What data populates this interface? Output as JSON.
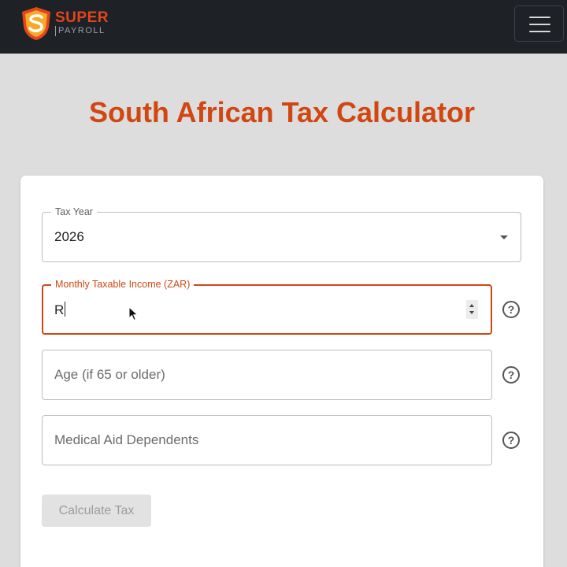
{
  "header": {
    "brand_top": "SUPER",
    "brand_bottom": "PAYROLL",
    "logo_icon": "shield-s-logo",
    "menu_icon": "hamburger-menu-icon"
  },
  "page": {
    "title": "South African Tax Calculator"
  },
  "form": {
    "tax_year": {
      "label": "Tax Year",
      "value": "2026"
    },
    "income": {
      "label": "Monthly Taxable Income (ZAR)",
      "value": "R"
    },
    "age": {
      "placeholder": "Age (if 65 or older)"
    },
    "dependents": {
      "placeholder": "Medical Aid Dependents"
    },
    "help_glyph": "?",
    "submit_label": "Calculate Tax"
  },
  "colors": {
    "accent": "#d04712",
    "navbar": "#1e2126",
    "background": "#dddddd"
  }
}
